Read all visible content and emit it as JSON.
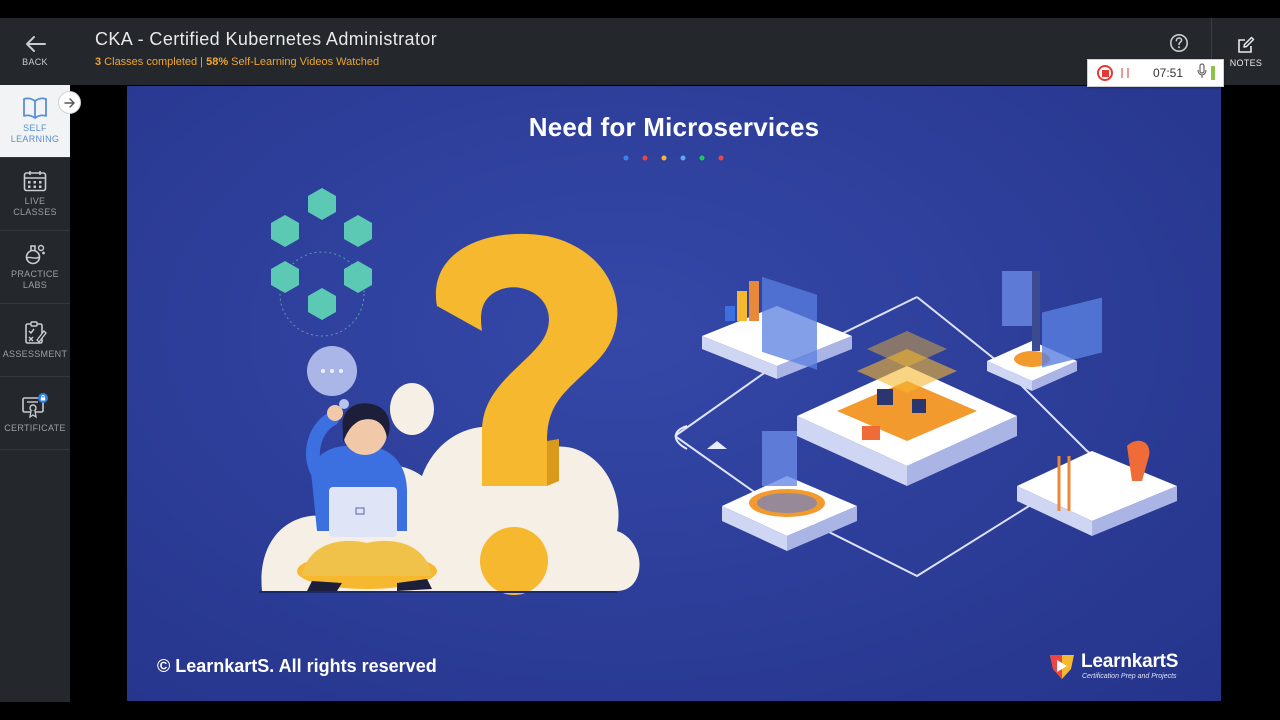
{
  "header": {
    "course_title": "CKA - Certified Kubernetes Administrator",
    "classes_completed_count": "3",
    "classes_completed_text": " Classes completed | ",
    "videos_percent": "58%",
    "videos_text": " Self-Learning Videos Watched",
    "notes_label": "NOTES",
    "help_icon": "question-circle-icon",
    "notes_icon": "edit-note-icon"
  },
  "sidebar": {
    "back_label": "BACK",
    "items": [
      {
        "label_1": "SELF",
        "label_2": "LEARNING",
        "icon": "open-book-icon",
        "active": true
      },
      {
        "label_1": "LIVE",
        "label_2": "CLASSES",
        "icon": "calendar-icon",
        "active": false
      },
      {
        "label_1": "PRACTICE",
        "label_2": "LABS",
        "icon": "flask-icon",
        "active": false
      },
      {
        "label_1": "ASSESSMENT",
        "label_2": "",
        "icon": "clipboard-check-icon",
        "active": false
      },
      {
        "label_1": "CERTIFICATE",
        "label_2": "",
        "icon": "certificate-lock-icon",
        "active": false
      }
    ]
  },
  "recorder": {
    "time": "07:51"
  },
  "slide": {
    "title": "Need for Microservices",
    "footer": "© LearnkartS. All rights reserved",
    "brand_name": "LearnkartS",
    "brand_tagline": "Certification Prep and Projects",
    "dot_colors": [
      "#3b82f6",
      "#ef4444",
      "#f5b82e",
      "#60a5fa",
      "#22c55e",
      "#ef4444"
    ]
  },
  "colors": {
    "accent_orange": "#f0a531",
    "sidebar_bg": "#24272b",
    "slide_bg": "#2c3d98",
    "active_blue": "#5b8fd6"
  }
}
